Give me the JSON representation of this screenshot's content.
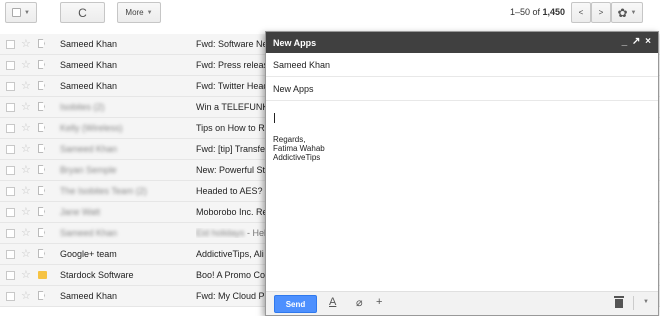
{
  "toolbar": {
    "more_label": "More",
    "page_info_range": "1–50 of ",
    "page_info_total": "1,450",
    "prev_glyph": "<",
    "next_glyph": ">",
    "refresh_glyph": "C",
    "caret": "▼",
    "gear_glyph": "✿"
  },
  "rows": [
    {
      "sender": "Sameed Khan",
      "subject": "Fwd: Software News:",
      "blurred": false
    },
    {
      "sender": "Sameed Khan",
      "subject": "Fwd: Press release: N",
      "blurred": false
    },
    {
      "sender": "Sameed Khan",
      "subject": "Fwd: Twitter Header In",
      "blurred": false
    },
    {
      "sender": "Isobites (2)",
      "subject": "Win a TELEFUNKEN C",
      "blurred": true
    },
    {
      "sender": "Kelly (Wireless)",
      "subject": "Tips on How to Rebuild",
      "blurred": true
    },
    {
      "sender": "Sameed Khan",
      "subject": "Fwd: [tip] Transfer you",
      "blurred": true
    },
    {
      "sender": "Bryan Semple",
      "subject": "New: Powerful Storage",
      "blurred": true
    },
    {
      "sender": "The Isobites Team (2)",
      "subject": "Headed to AES? Com",
      "blurred": true
    },
    {
      "sender": "Jane Watt",
      "subject": "Moborobo Inc. Release",
      "blurred": true
    },
    {
      "sender": "Sameed Khan",
      "subject_blur": "Eid holidays",
      "subject": " - Hello all",
      "blurred": true
    },
    {
      "sender": "Google+ team",
      "subject": "AddictiveTips, Ali Waq",
      "blurred": false
    },
    {
      "sender": "Stardock Software",
      "subject": "Boo! A Promo Code fo",
      "blurred": false,
      "folder": true
    },
    {
      "sender": "Sameed Khan",
      "subject": "Fwd: My Cloud Player",
      "blurred": false
    }
  ],
  "compose": {
    "title": "New Apps",
    "controls": "_ ↗ ×",
    "to": "Sameed Khan",
    "subject": "New Apps",
    "signature": [
      "Regards,",
      "Fatima Wahab",
      "AddictiveTips"
    ],
    "send_label": "Send",
    "format_glyph": "A",
    "attach_glyph": "⌀",
    "insert_glyph": "+",
    "more_caret": "▼"
  },
  "icons": {
    "star": "☆"
  }
}
